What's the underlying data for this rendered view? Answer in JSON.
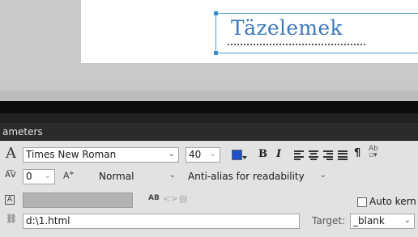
{
  "stage": {
    "text_content": "Täzelemek"
  },
  "panel": {
    "title": "ameters"
  },
  "text_props": {
    "font_family": "Times New Roman",
    "font_size": "40",
    "text_color": "#1f4fc8",
    "bold_label": "B",
    "italic_label": "I",
    "paragraph_glyph": "¶",
    "letter_spacing": "0",
    "char_position": "Normal",
    "antialias": "Anti-alias for readability"
  },
  "options": {
    "auto_kern_label": "Auto kern",
    "link_url": "d:\\1.html",
    "target_label": "Target:",
    "target_value": "_blank"
  },
  "icons": {
    "font_type": "A",
    "chevron": "⌵"
  }
}
